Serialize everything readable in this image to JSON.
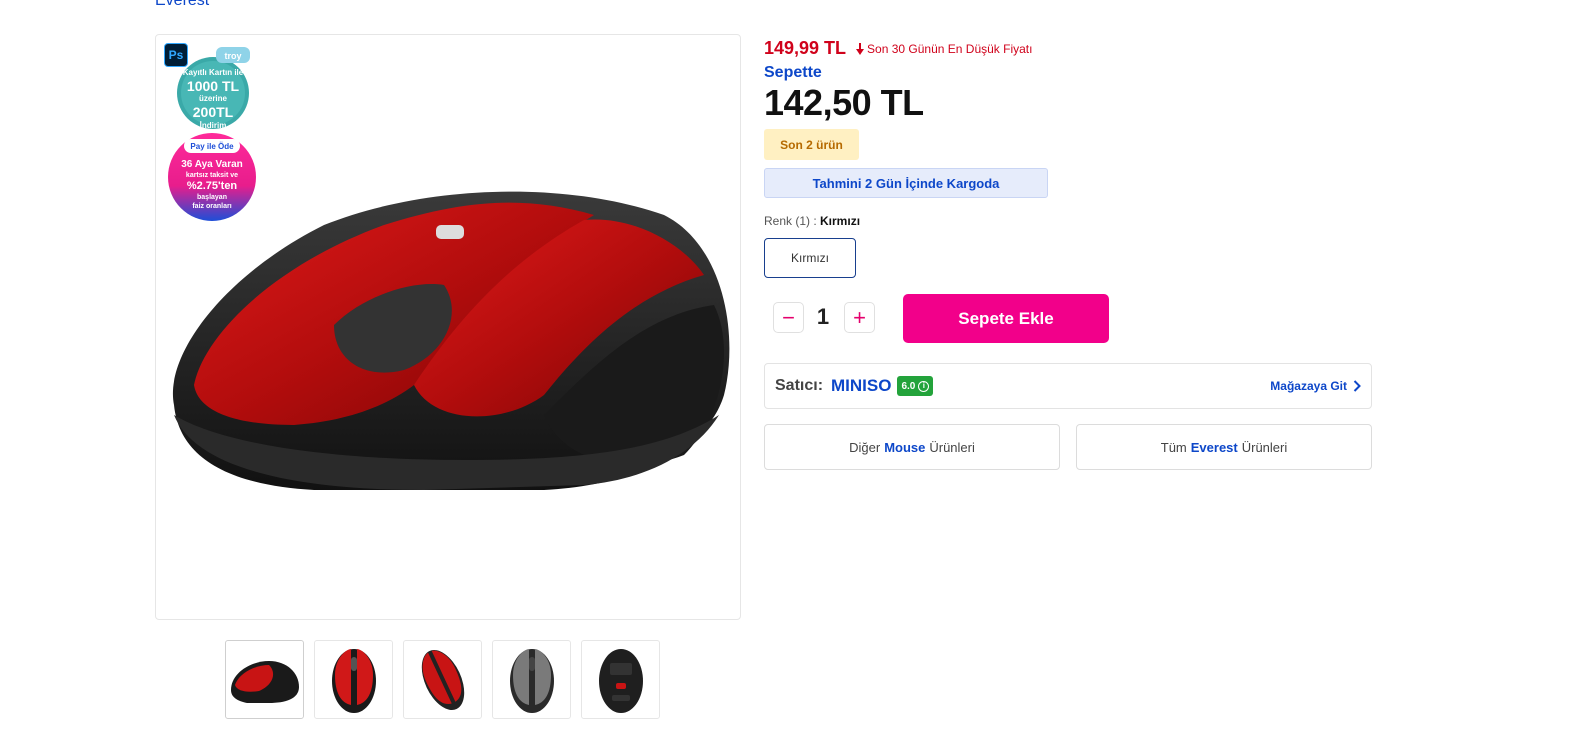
{
  "brand": {
    "name": "Everest"
  },
  "gallery": {
    "ps_badge": "Ps",
    "promo_troy": {
      "brand": "troy",
      "lines": [
        "Kayıtlı Kartın ile",
        "1000 TL",
        "üzerine",
        "200TL",
        "İndirim"
      ]
    },
    "promo_pay": {
      "lines": [
        "Pay ile Öde",
        "36 Aya Varan",
        "kartsız taksit ve",
        "%2.75'ten",
        "başlayan",
        "faiz oranları"
      ]
    },
    "thumbnail_count": 5
  },
  "pricing": {
    "old_price": "149,99 TL",
    "lowest_note": "Son 30 Günün En Düşük Fiyatı",
    "sepette_label": "Sepette",
    "new_price": "142,50 TL"
  },
  "stock": {
    "badge": "Son 2 ürün"
  },
  "shipping": {
    "text": "Tahmini 2 Gün İçinde Kargoda"
  },
  "color": {
    "label": "Renk (1) : ",
    "selected": "Kırmızı",
    "options": [
      "Kırmızı"
    ]
  },
  "quantity": {
    "value": "1",
    "minus": "−",
    "plus": "+"
  },
  "cart": {
    "button_label": "Sepete Ekle"
  },
  "seller": {
    "label": "Satıcı:",
    "name": "MINISO",
    "score": "6.0",
    "store_link": "Mağazaya Git"
  },
  "related": {
    "left": {
      "prefix": "Diğer",
      "keyword": "Mouse",
      "suffix": "Ürünleri"
    },
    "right": {
      "prefix": "Tüm",
      "keyword": "Everest",
      "suffix": "Ürünleri"
    }
  },
  "colors": {
    "accent_pink": "#f2008a",
    "brand_blue": "#0d47c9",
    "price_red": "#d0021b"
  }
}
